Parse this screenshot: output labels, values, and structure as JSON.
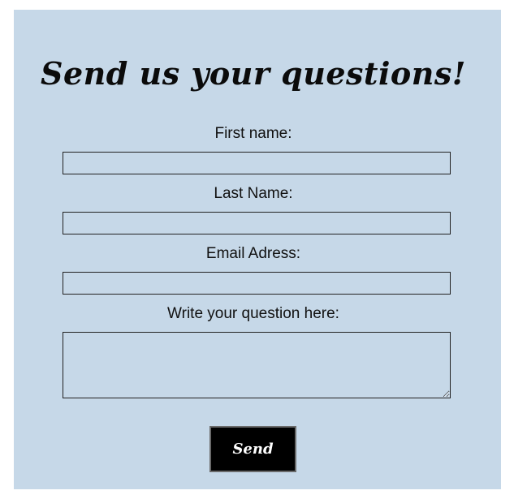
{
  "form": {
    "title": "Send us your questions!",
    "fields": [
      {
        "label": "First name:",
        "value": "",
        "placeholder": ""
      },
      {
        "label": "Last Name:",
        "value": "",
        "placeholder": ""
      },
      {
        "label": "Email Adress:",
        "value": "",
        "placeholder": ""
      }
    ],
    "question": {
      "label": "Write your question here:",
      "value": "",
      "placeholder": ""
    },
    "submit_label": "Send"
  },
  "colors": {
    "panel_background": "#c6d8e8",
    "button_background": "#000000",
    "button_text": "#ffffff",
    "text": "#111111"
  }
}
